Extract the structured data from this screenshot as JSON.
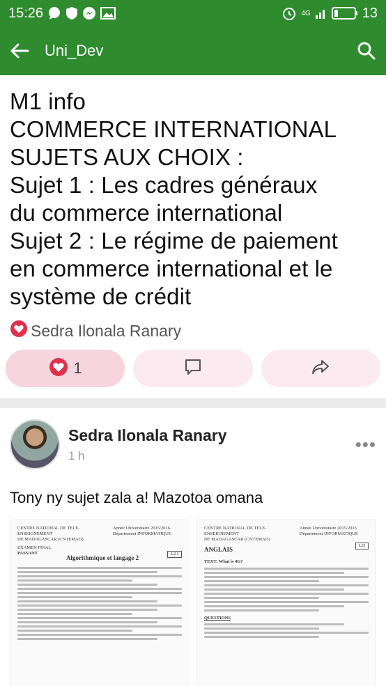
{
  "statusbar": {
    "time": "15:26",
    "network": "4G",
    "battery": "13"
  },
  "appbar": {
    "title": "Uni_Dev"
  },
  "post": {
    "text": "M1 info\nCOMMERCE INTERNATIONAL\n SUJETS AUX CHOIX :\nSujet 1 : Les cadres généraux\ndu commerce international\nSujet 2 : Le régime de paiement\nen commerce international et le\nsystème de crédit",
    "author": "Sedra Ilonala Ranary",
    "like_count": "1"
  },
  "comment": {
    "name": "Sedra Ilonala Ranary",
    "time": "1 h",
    "text": "Tony ny sujet zala a! Mazotoa omana",
    "doc1": {
      "header_left": "CENTRE NATIONAL DE TELE-ENSEIGNEMENT\nDE MADAGASCAR (CNTEMAD)",
      "header_right": "Année Universitaire 2015/2016\nDépartement INFORMATIQUE",
      "title": "Algorithmique et langage 2",
      "code": "L2 I",
      "exam": "EXAMEN FINAL",
      "passant": "PASSANT"
    },
    "doc2": {
      "header_left": "CENTRE NATIONAL DE TELE-ENSEIGNEMENT\nDE MADAGASCAR (CNTEMAD)",
      "header_right": "Année Universitaire 2015/2016\nDépartement INFORMATIQUE",
      "title": "ANGLAIS",
      "code": "L2I",
      "text_title": "TEXT: What is 4G?",
      "section": "QUESTIONS"
    }
  },
  "colors": {
    "brand_green": "#2e8b2e",
    "like_red": "#e0314b"
  }
}
